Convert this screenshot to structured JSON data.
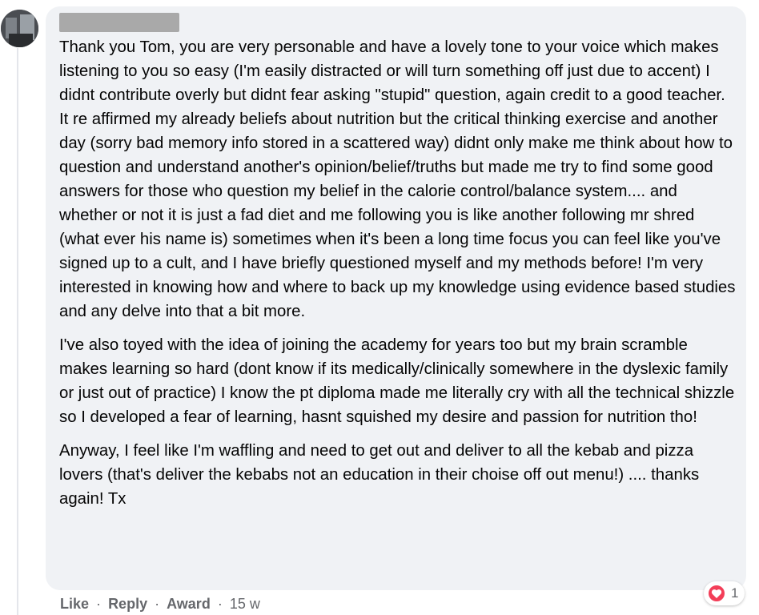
{
  "comment": {
    "author_name_redacted": true,
    "paragraphs": [
      "Thank you Tom, you are very personable and have a lovely tone to your voice which makes listening to you so easy (I'm easily distracted or will turn something off just due to accent) I didnt contribute overly but didnt fear asking \"stupid\" question, again credit to a good teacher.",
      "It re affirmed my already beliefs about nutrition but the critical thinking exercise and another day (sorry bad memory info stored in a scattered way) didnt only make me think about how to question and understand another's opinion/belief/truths but made me try to find some good answers for those who question my belief in the calorie control/balance system.... and whether or not it is just a fad diet and me following you is like another following mr shred (what ever his name is) sometimes when it's been a long time focus you can feel like you've signed up to a cult, and I have briefly questioned myself and my methods before! I'm very interested in knowing how and where to back up my knowledge using evidence based studies and any delve into that a bit more.",
      "I've also toyed with the idea of joining the academy for years too but my brain scramble makes learning so hard (dont know if its medically/clinically somewhere in the dyslexic family or just out of practice) I know the pt diploma made me literally cry with all the technical shizzle so I developed a fear of learning, hasnt squished my desire and passion for nutrition tho!",
      "Anyway, I feel like I'm waffling and need to get out and deliver to all the kebab and pizza lovers (that's deliver the kebabs not an education in their choise off out menu!) .... thanks again! Tx"
    ]
  },
  "actions": {
    "like": "Like",
    "reply": "Reply",
    "award": "Award",
    "separator": "·",
    "time": "15 w"
  },
  "reactions": {
    "icon": "heart-icon",
    "color": "#f33e58",
    "count": "1"
  }
}
